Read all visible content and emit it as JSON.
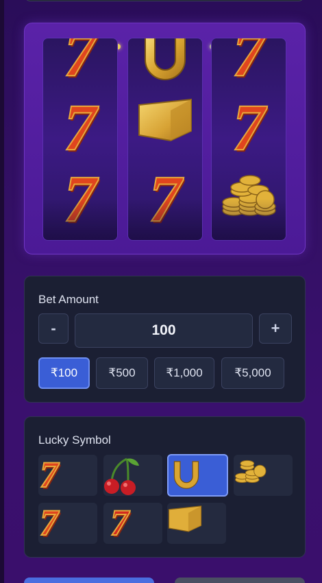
{
  "slot": {
    "lights": [
      "#e03a3a",
      "#e8d060",
      "#a02a5a",
      "#b0b0a0",
      "#e03a3a"
    ],
    "reels": [
      [
        "seven",
        "seven",
        "seven"
      ],
      [
        "horseshoe",
        "gold-bar",
        "seven"
      ],
      [
        "seven",
        "seven",
        "gold-coins"
      ]
    ],
    "seven_glyph": "7"
  },
  "bet": {
    "title": "Bet Amount",
    "minus_label": "-",
    "plus_label": "+",
    "amount": "100",
    "chips": [
      "₹100",
      "₹500",
      "₹1,000",
      "₹5,000"
    ],
    "active_chip": "₹100"
  },
  "lucky": {
    "title": "Lucky Symbol",
    "symbols": [
      "seven",
      "cherries",
      "horseshoe",
      "gold-coins",
      "seven",
      "seven",
      "gold-bar"
    ],
    "selected": "horseshoe",
    "seven_glyph": "7"
  }
}
